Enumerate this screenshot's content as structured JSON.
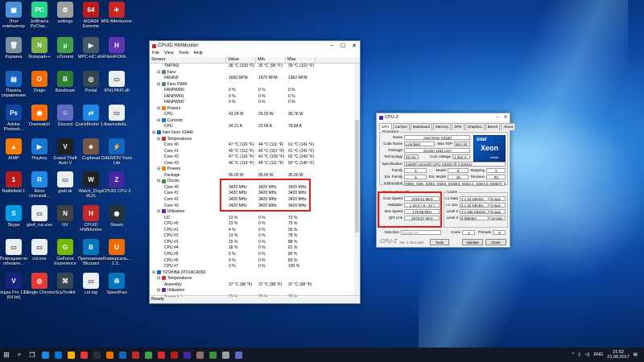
{
  "desktop_icons": [
    {
      "label": "Этот компьютер",
      "color": "#4a90d9",
      "glyph": "▣"
    },
    {
      "label": "JetBrains PyChar...",
      "color": "#21d789",
      "glyph": "PC"
    },
    {
      "label": "settings",
      "color": "#9e9e9e",
      "glyph": "⚙"
    },
    {
      "label": "AIDA64 Extreme",
      "color": "#b71c1c",
      "glyph": "64"
    },
    {
      "label": "MSI Afterburner",
      "color": "#c62828",
      "glyph": "✈"
    },
    {
      "label": "Корзина",
      "color": "#78909c",
      "glyph": "🗑"
    },
    {
      "label": "Notepad++",
      "color": "#7cb342",
      "glyph": "N"
    },
    {
      "label": "uTorrent",
      "color": "#43a047",
      "glyph": "µ"
    },
    {
      "label": "MPC-HC x64",
      "color": "#455a64",
      "glyph": "▶"
    },
    {
      "label": "FileHFO64...",
      "color": "#5e35b1",
      "glyph": "H"
    },
    {
      "label": "Панель управления",
      "color": "#1565c0",
      "glyph": "▤"
    },
    {
      "label": "Origin",
      "color": "#ef6c00",
      "glyph": "O"
    },
    {
      "label": "Bandicam",
      "color": "#2e7d32",
      "glyph": "B"
    },
    {
      "label": "Portal",
      "color": "#37474f",
      "glyph": "◎"
    },
    {
      "label": "IPHLPAPI.dll",
      "color": "#eceff1",
      "glyph": "▭"
    },
    {
      "label": "Adobe Photosh...",
      "color": "#0d47a1",
      "glyph": "Ps"
    },
    {
      "label": "Overwatch",
      "color": "#ff6f00",
      "glyph": "◉"
    },
    {
      "label": "Discord",
      "color": "#5c6bc0",
      "glyph": "☺"
    },
    {
      "label": "QuickBinder 1.1",
      "color": "#1e88e5",
      "glyph": "⇄"
    },
    {
      "label": "mavesdefa...",
      "color": "#eceff1",
      "glyph": "▭"
    },
    {
      "label": "AIMP",
      "color": "#f57c00",
      "glyph": "▲"
    },
    {
      "label": "Playkey",
      "color": "#1976d2",
      "glyph": "▶"
    },
    {
      "label": "Grand Theft Auto V",
      "color": "#212121",
      "glyph": "V"
    },
    {
      "label": "Cuphead",
      "color": "#795548",
      "glyph": "☻"
    },
    {
      "label": "DAEMON Tools Lite",
      "color": "#1565c0",
      "glyph": "⚡"
    },
    {
      "label": "Battlefield 1",
      "color": "#b71c1c",
      "glyph": "1"
    },
    {
      "label": "Revo Uninstall...",
      "color": "#1e88e5",
      "glyph": "R"
    },
    {
      "label": "gtaIl.sk",
      "color": "#eceff1",
      "glyph": "▭"
    },
    {
      "label": "Watch_Dogs RUS",
      "color": "#212121",
      "glyph": "W"
    },
    {
      "label": "CPUID CPU-Z",
      "color": "#4527a0",
      "glyph": "Z"
    },
    {
      "label": "Skype",
      "color": "#039be5",
      "glyph": "S"
    },
    {
      "label": "gta4_rus.exe",
      "color": "#eceff1",
      "glyph": "▭"
    },
    {
      "label": "NV",
      "color": "#424242",
      "glyph": "N"
    },
    {
      "label": "CPUID HWMonitor",
      "color": "#c62828",
      "glyph": "H"
    },
    {
      "label": "Steam",
      "color": "#263238",
      "glyph": "◉"
    },
    {
      "label": "Помощник по обновле...",
      "color": "#eceff1",
      "glyph": "▭"
    },
    {
      "label": "cst.exe",
      "color": "#eceff1",
      "glyph": "▭"
    },
    {
      "label": "GeForce Experience",
      "color": "#76b900",
      "glyph": "G"
    },
    {
      "label": "Приложение Blizzard",
      "color": "#0277bd",
      "glyph": "B"
    },
    {
      "label": "Универсаль... 2.3...",
      "color": "#ef6c00",
      "glyph": "U"
    },
    {
      "label": "Vegas Pro 13.0 (64 bit)",
      "color": "#1a237e",
      "glyph": "V"
    },
    {
      "label": "Google Chrome",
      "color": "#e53935",
      "glyph": "◎"
    },
    {
      "label": "ScpToolkit",
      "color": "#37474f",
      "glyph": "⌘"
    },
    {
      "label": "cst.log",
      "color": "#eceff1",
      "glyph": "▭"
    },
    {
      "label": "SpeedFan",
      "color": "#0277bd",
      "glyph": "✇"
    }
  ],
  "hwmonitor": {
    "title": "CPUID HWMonitor",
    "menu": [
      "File",
      "View",
      "Tools",
      "Help"
    ],
    "columns": [
      "Sensor",
      "Value",
      "Min",
      "Max"
    ],
    "rows": [
      [
        "TMPIN2",
        "38 °C (100 °F)",
        "35 °C",
        "(95 °F)",
        "39 °C (102 °F)",
        6
      ],
      [
        "Fans",
        "",
        "",
        "",
        "",
        3
      ],
      [
        "FANIN0",
        "1600 RPM",
        "1670 RPM",
        "",
        "1962 RPM",
        6
      ],
      [
        "Fans PWM",
        "",
        "",
        "",
        "",
        3
      ],
      [
        "FANPWM0",
        "0 %",
        "0 %",
        "",
        "0 %",
        6
      ],
      [
        "FANPWM1",
        "0 %",
        "0 %",
        "",
        "0 %",
        6
      ],
      [
        "FANPWM2",
        "0 %",
        "0 %",
        "",
        "0 %",
        6
      ],
      [
        "Powers",
        "",
        "",
        "",
        "",
        3
      ],
      [
        "CPU",
        "43.24 W",
        "29.93 W",
        "",
        "99.78 W",
        6
      ],
      [
        "Currents",
        "",
        "",
        "",
        "",
        3
      ],
      [
        "CPU",
        "34.21 A",
        "23.68 A",
        "",
        "78.84 A",
        6
      ],
      [
        "Intel Xeon X3440",
        "",
        "",
        "",
        "",
        1
      ],
      [
        "Temperatures",
        "",
        "",
        "",
        "",
        3
      ],
      [
        "Core #0",
        "47 °C (116 °F)",
        "44 °C (111 °F)",
        "",
        "61 °C (141 °F)",
        6
      ],
      [
        "Core #1",
        "45 °C (113 °F)",
        "42 °C (107 °F)",
        "",
        "61 °C (141 °F)",
        6
      ],
      [
        "Core #2",
        "47 °C (116 °F)",
        "43 °C (109 °F)",
        "",
        "62 °C (143 °F)",
        6
      ],
      [
        "Core #3",
        "46 °C (114 °F)",
        "44 °C (111 °F)",
        "",
        "60 °C (140 °F)",
        6
      ],
      [
        "Powers",
        "",
        "",
        "",
        "",
        3
      ],
      [
        "Package",
        "95.00 W",
        "95.00 W",
        "",
        "95.00 W",
        6
      ],
      [
        "Clocks",
        "",
        "",
        "",
        "",
        3
      ],
      [
        "Core #0",
        "3420 MHz",
        "3420 MHz",
        "",
        "3420 MHz",
        6
      ],
      [
        "Core #1",
        "3420 MHz",
        "3420 MHz",
        "",
        "3420 MHz",
        6
      ],
      [
        "Core #2",
        "3420 MHz",
        "3420 MHz",
        "",
        "3420 MHz",
        6
      ],
      [
        "Core #3",
        "3420 MHz",
        "3420 MHz",
        "",
        "3420 MHz",
        6
      ],
      [
        "Utilization",
        "",
        "",
        "",
        "",
        3
      ],
      [
        "UC",
        "13 %",
        "0 %",
        "",
        "73 %",
        6
      ],
      [
        "CPU #0",
        "23 %",
        "0 %",
        "",
        "75 %",
        6
      ],
      [
        "CPU #1",
        "4 %",
        "0 %",
        "",
        "96 %",
        6
      ],
      [
        "CPU #2",
        "13 %",
        "0 %",
        "",
        "78 %",
        6
      ],
      [
        "CPU #3",
        "15 %",
        "0 %",
        "",
        "88 %",
        6
      ],
      [
        "CPU #4",
        "18 %",
        "0 %",
        "",
        "81 %",
        6
      ],
      [
        "CPU #5",
        "6 %",
        "0 %",
        "",
        "80 %",
        6
      ],
      [
        "CPU #6",
        "3 %",
        "0 %",
        "",
        "83 %",
        6
      ],
      [
        "CPU #7",
        "3 %",
        "0 %",
        "",
        "100 %",
        6
      ],
      [
        "TOSHIBA DT01ACA050",
        "",
        "",
        "",
        "",
        1
      ],
      [
        "Temperatures",
        "",
        "",
        "",
        "",
        3
      ],
      [
        "Assembly",
        "37 °C (98 °F)",
        "37 °C (98 °F)",
        "",
        "37 °C (98 °F)",
        6
      ],
      [
        "Utilization",
        "",
        "",
        "",
        "",
        3
      ],
      [
        "Space (c:)",
        "79 %",
        "79 %",
        "",
        "79 %",
        6
      ]
    ],
    "status": "Ready",
    "highlight_color": "#e02020"
  },
  "cpuz": {
    "title": "CPU-Z",
    "tabs": [
      "CPU",
      "Caches",
      "Mainboard",
      "Memory",
      "SPD",
      "Graphics",
      "Bench",
      "About"
    ],
    "processor_group": "Processor",
    "fields": {
      "name": "Intel Xeon X3440",
      "code_name": "Lynnfield",
      "max_tdp": "95.0 W",
      "package": "Socket 1156 LGA",
      "technology": "45 nm",
      "core_voltage": "1.264 V",
      "specification": "Intel(R) Xeon(R) CPU      X3440 @ 2.53GHz",
      "family": "6",
      "model": "E",
      "stepping": "5",
      "ext_family": "6",
      "ext_model": "1E",
      "revision": "B1",
      "instructions": "MMX, SSE, SSE2, SSE3, SSSE3, SSE4.1, SSE4.2, EM64T, VT-x",
      "core_speed": "3419.61 MHz",
      "multiplier": "x 26.0 ( 9 - 22 )",
      "bus_speed": "179.98 MHz",
      "qpi_link": "2879.67 MHz",
      "l1_data": "4 x 32 KBytes",
      "l1_data_way": "8-way",
      "l1_inst": "4 x 32 KBytes",
      "l1_inst_way": "4-way",
      "level2": "4 x 256 KBytes",
      "level2_way": "8-way",
      "level3": "8 MBytes",
      "level3_way": "16-way",
      "selection": "Socket #1",
      "cores": "4",
      "threads": "8"
    },
    "labels": {
      "name": "Name",
      "code_name": "Code Name",
      "max_tdp": "Max TDP",
      "package": "Package",
      "technology": "Technology",
      "core_voltage": "Core Voltage",
      "specification": "Specification",
      "family": "Family",
      "model": "Model",
      "stepping": "Stepping",
      "ext_family": "Ext. Family",
      "ext_model": "Ext. Model",
      "revision": "Revision",
      "instructions": "Instructions",
      "clocks_group": "Clocks (Core #0)",
      "cache_group": "Cache",
      "core_speed": "Core Speed",
      "multiplier": "Multiplier",
      "bus_speed": "Bus Speed",
      "qpi_link": "QPI Link",
      "l1_data": "L1 Data",
      "l1_inst": "L1 Inst.",
      "level2": "Level 2",
      "level3": "Level 3",
      "selection": "Selection",
      "cores": "Cores",
      "threads": "Threads"
    },
    "logo": {
      "brand": "intel",
      "line1": "Xeon",
      "line2": "inside"
    },
    "footer": {
      "version": "Ver. 1.79.1.x64",
      "tools": "Tools",
      "validate": "Validate",
      "close": "Close",
      "brand": "CPU-Z"
    }
  },
  "taskbar": {
    "pinned_colors": [
      "#1e88e5",
      "#0078d7",
      "#ffb300",
      "#e53935",
      "#263238",
      "#ef6c00",
      "#1565c0",
      "#c62828",
      "#43a047",
      "#d32f2f",
      "#b71c1c",
      "#4527a0",
      "#8d6e63",
      "#388e3c",
      "#9e9e9e",
      "#5c6bc0"
    ],
    "language": "ENG",
    "time": "21:52",
    "date": "21.08.2017"
  }
}
